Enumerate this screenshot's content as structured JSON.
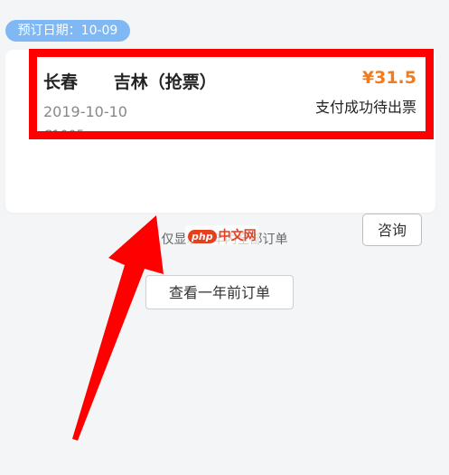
{
  "date_badge": "预订日期：10-09",
  "order": {
    "route": "长春      吉林（抢票）",
    "price": "¥31.5",
    "status": "支付成功待出票",
    "date": "2019-10-10",
    "train_no": "C1005"
  },
  "consult_label": "咨询",
  "notice_text": "仅显示一年内全部订单",
  "watermark": {
    "logo": "php",
    "text": "中文网"
  },
  "history_label": "查看一年前订单",
  "colors": {
    "highlight": "#ff0000",
    "price": "#f07c1f",
    "badge": "#7fb8f3"
  }
}
